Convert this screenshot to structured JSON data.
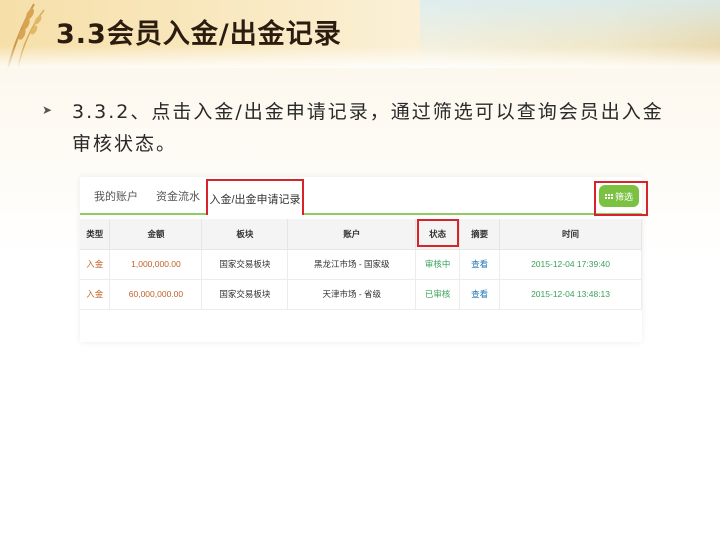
{
  "slide": {
    "title": "3.3会员入金/出金记录",
    "bullet": "3.3.2、点击入金/出金申请记录，通过筛选可以查询会员出入金审核状态。"
  },
  "tabs": [
    {
      "label": "我的账户",
      "active": false
    },
    {
      "label": "资金流水",
      "active": false
    },
    {
      "label": "入金/出金申请记录",
      "active": true
    }
  ],
  "filter_button": {
    "label": "筛选",
    "icon": "grid-icon",
    "color": "#7bc142"
  },
  "table": {
    "headers": [
      "类型",
      "金额",
      "板块",
      "账户",
      "状态",
      "摘要",
      "时间"
    ],
    "rows": [
      [
        "入金",
        "1,000,000.00",
        "国家交易板块",
        "黑龙江市场 - 国家级",
        "审核中",
        "查看",
        "2015-12-04 17:39:40"
      ],
      [
        "入金",
        "60,000,000.00",
        "国家交易板块",
        "天津市场 - 省级",
        "已审核",
        "查看",
        "2015-12-04 13:48:13"
      ]
    ]
  },
  "colors": {
    "highlight": "#d9232a",
    "accent_green": "#7bc142",
    "link_blue": "#1f76b5",
    "amount_orange": "#c0612a"
  }
}
